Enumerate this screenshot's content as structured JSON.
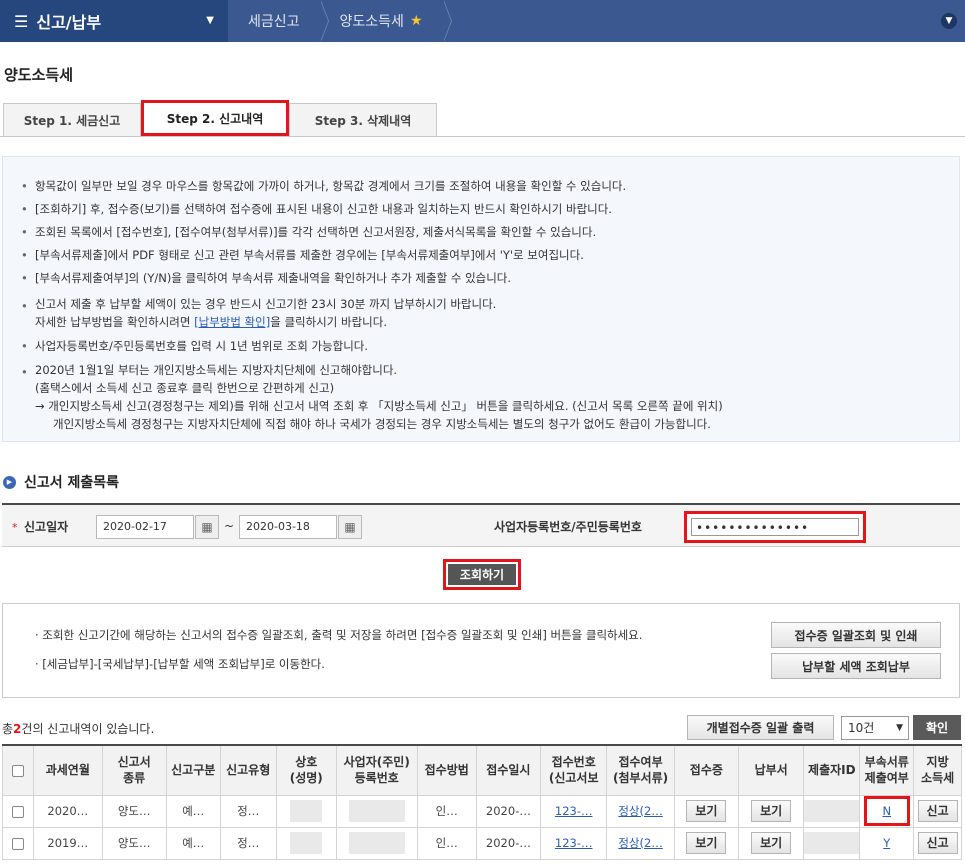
{
  "topbar": {
    "menu_title": "신고/납부",
    "crumbs": [
      "세금신고",
      "양도소득세"
    ]
  },
  "page_title": "양도소득세",
  "tabs": [
    "Step 1. 세금신고",
    "Step 2. 신고내역",
    "Step 3. 삭제내역"
  ],
  "info": {
    "bullets": [
      "항목값이 일부만 보일 경우 마우스를 항목값에 가까이 하거나, 항목값 경계에서 크기를 조절하여 내용을 확인할 수 있습니다.",
      "[조회하기] 후, 접수증(보기)를 선택하여 접수증에 표시된 내용이 신고한 내용과 일치하는지 반드시 확인하시기 바랍니다.",
      "조회된 목록에서 [접수번호], [접수여부(첨부서류)]를 각각 선택하면 신고서원장, 제출서식목록을 확인할 수 있습니다.",
      "[부속서류제출]에서 PDF 형태로 신고 관련 부속서류를 제출한 경우에는 [부속서류제출여부]에서 'Y'로 보여집니다.",
      "[부속서류제출여부]의 (Y/N)을 클릭하여 부속서류 제출내역을 확인하거나 추가 제출할 수 있습니다."
    ],
    "b6_line1": "신고서 제출 후 납부할 세액이 있는 경우 반드시 신고기한 23시 30분 까지 납부하시기 바랍니다.",
    "b6_line2_pre": "자세한 납부방법을 확인하시려면 ",
    "b6_link": "[납부방법 확인]",
    "b6_line2_post": "을 클릭하시기 바랍니다.",
    "b7": "사업자등록번호/주민등록번호를 입력 시 1년 범위로 조회 가능합니다.",
    "b8_line1": "2020년 1월1일 부터는 개인지방소득세는 지방자치단체에 신고해야합니다.",
    "b8_line2": "(홈택스에서 소득세 신고 종료후 클릭 한번으로 간편하게 신고)",
    "b8_line3": "→ 개인지방소득세 신고(경정청구는 제외)를 위해 신고서 내역 조회 후 「지방소득세 신고」 버튼을 클릭하세요. (신고서 목록 오른쪽 끝에 위치)",
    "b8_line4": "개인지방소득세 경정청구는 지방자치단체에 직접 해야 하나 국세가 경정되는 경우 지방소득세는 별도의 청구가 없어도 환급이 가능합니다."
  },
  "section_title": "신고서 제출목록",
  "search": {
    "required_mark": "*",
    "date_label": "신고일자",
    "date_from": "2020-02-17",
    "date_to": "2020-03-18",
    "tilde": "~",
    "biz_label": "사업자등록번호/주민등록번호",
    "biz_value": "••••••••••••••",
    "search_button": "조회하기"
  },
  "notice": {
    "line1": "· 조회한 신고기간에 해당하는 신고서의 접수증 일괄조회, 출력 및 저장을 하려면 [접수증 일괄조회 및 인쇄] 버튼을 클릭하세요.",
    "line2": "· [세금납부]-[국세납부]-[납부할 세액 조회납부]로 이동한다.",
    "btn_batch": "접수증 일괄조회 및 인쇄",
    "btn_pay": "납부할 세액 조회납부"
  },
  "list": {
    "count_pre": "총",
    "count": "2",
    "count_post": "건의 신고내역이 있습니다.",
    "btn_print": "개별접수증 일괄 출력",
    "page_size": "10건",
    "btn_confirm": "확인"
  },
  "table": {
    "headers": [
      "과세연월",
      "신고서\n종류",
      "신고구분",
      "신고유형",
      "상호\n(성명)",
      "사업자(주민)\n등록번호",
      "접수방법",
      "접수일시",
      "접수번호\n(신고서보",
      "접수여부\n(첨부서류)",
      "접수증",
      "납부서",
      "제출자ID",
      "부속서류\n제출여부",
      "지방\n소득세"
    ],
    "rows": [
      {
        "period": "2020…",
        "kind": "양도…",
        "div": "예…",
        "type": "정…",
        "method": "인…",
        "datetime": "2020-…",
        "receipt_no": "123-…",
        "status": "정상(2…",
        "receipt_btn": "보기",
        "bill_btn": "보기",
        "attach": "N",
        "local_btn": "신고"
      },
      {
        "period": "2019…",
        "kind": "양도…",
        "div": "예…",
        "type": "정…",
        "method": "인…",
        "datetime": "2020-…",
        "receipt_no": "123-…",
        "status": "정상(2…",
        "receipt_btn": "보기",
        "bill_btn": "보기",
        "attach": "Y",
        "local_btn": "신고"
      }
    ]
  },
  "colors": {
    "topbar": "#3c5890",
    "highlight": "#e5141b",
    "link": "#2a5cb8"
  }
}
